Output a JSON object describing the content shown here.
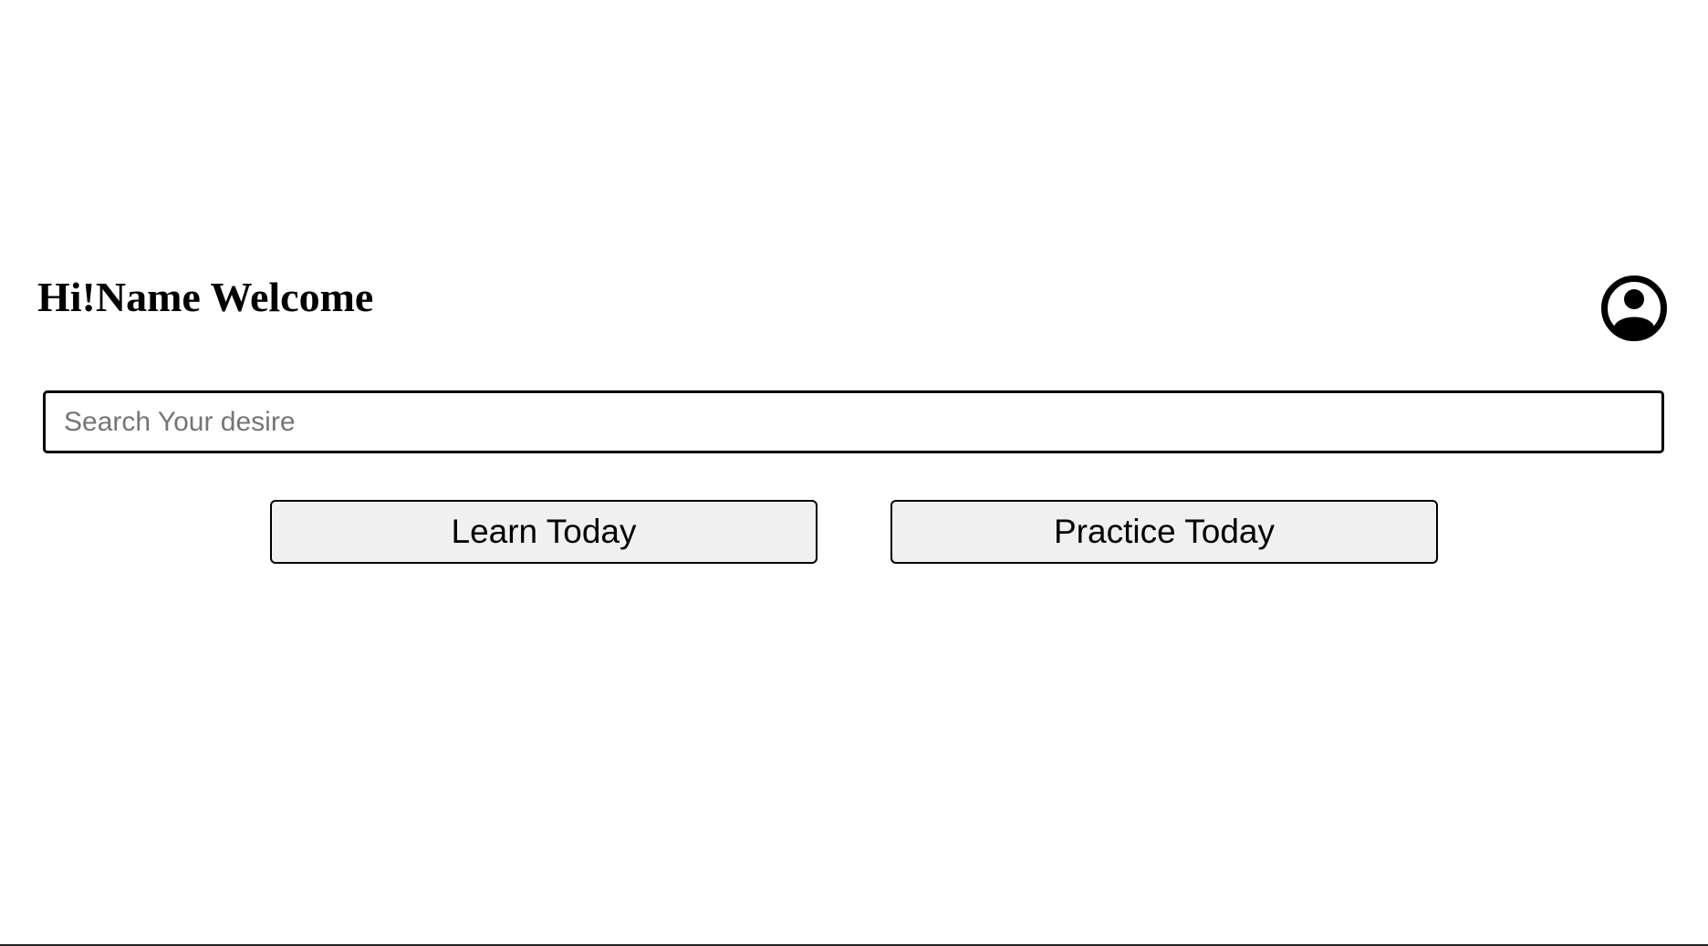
{
  "header": {
    "greeting": "Hi!Name Welcome",
    "profile_icon": "user-circle-icon"
  },
  "search": {
    "placeholder": "Search Your desire",
    "value": ""
  },
  "actions": {
    "learn_label": "Learn Today",
    "practice_label": "Practice Today"
  },
  "colors": {
    "text": "#000000",
    "button_background": "#f0f0f0",
    "placeholder": "#757575",
    "page_background": "#ffffff"
  }
}
